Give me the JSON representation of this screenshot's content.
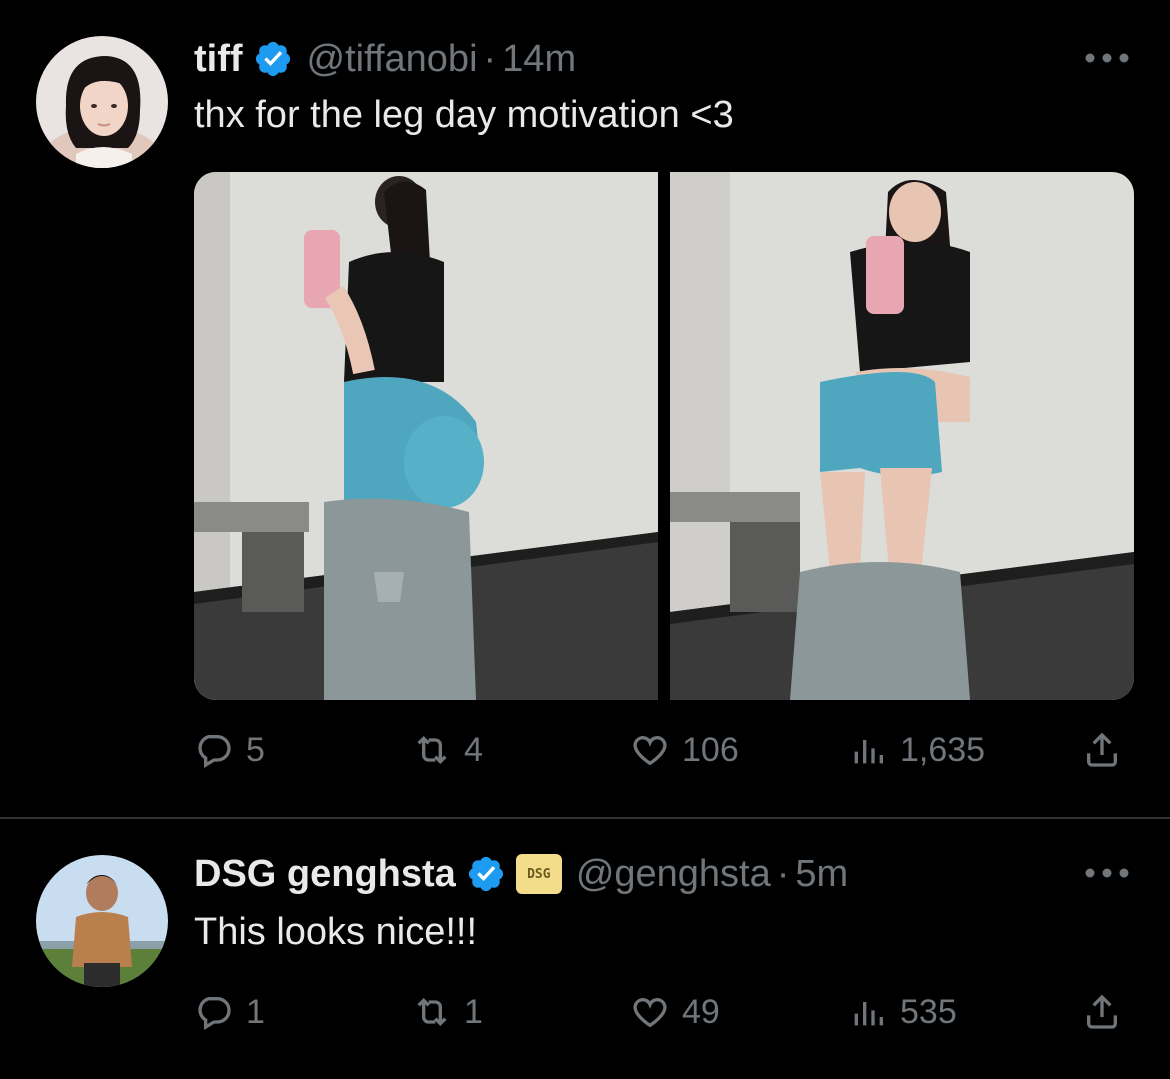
{
  "tweets": [
    {
      "author_name": "tiff",
      "handle": "@tiffanobi",
      "separator": "·",
      "time": "14m",
      "text": "thx for the leg day motivation <3",
      "replies": "5",
      "retweets": "4",
      "likes": "106",
      "views": "1,635",
      "media_count": 2
    },
    {
      "author_name": "DSG genghsta",
      "affiliate_badge": "DSG",
      "handle": "@genghsta",
      "separator": "·",
      "time": "5m",
      "text": "This looks nice!!!",
      "replies": "1",
      "retweets": "1",
      "likes": "49",
      "views": "535"
    }
  ],
  "colors": {
    "background": "#000000",
    "primary_text": "#e7e9ea",
    "secondary_text": "#71767b",
    "verified_blue": "#1d9bf0",
    "divider": "#2f3336"
  },
  "icons": [
    "verified-badge-icon",
    "more-icon",
    "reply-icon",
    "retweet-icon",
    "like-icon",
    "views-icon",
    "share-icon"
  ]
}
